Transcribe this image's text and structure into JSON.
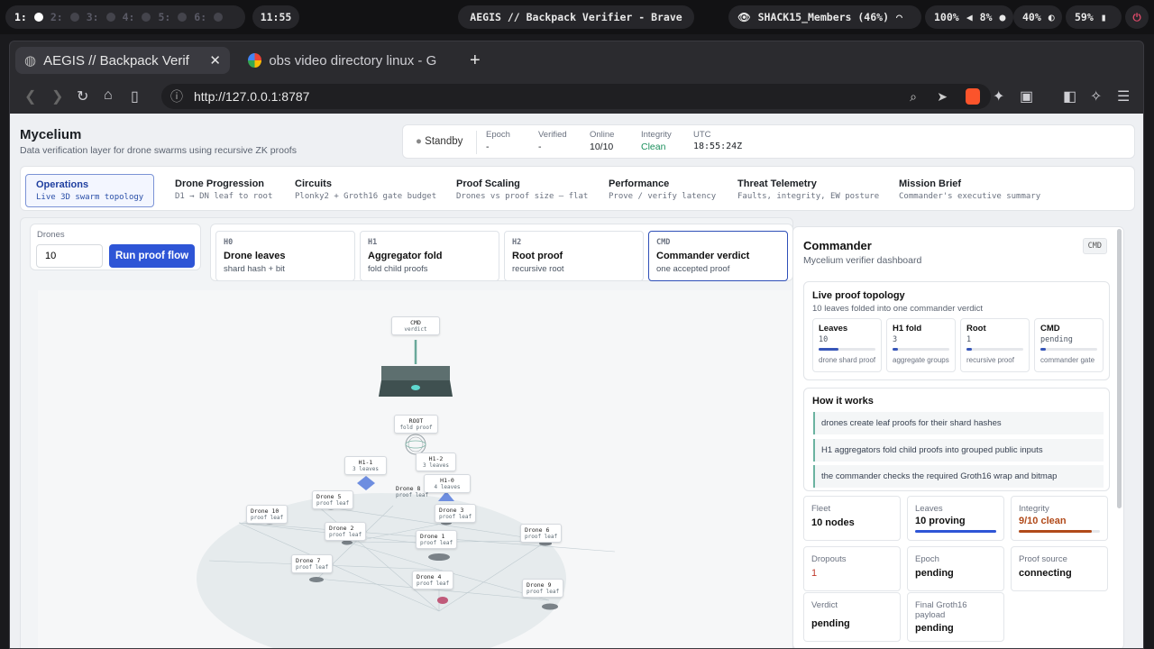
{
  "sysbar": {
    "workspaces": [
      "1:",
      "2:",
      "3:",
      "4:",
      "5:",
      "6:"
    ],
    "clock": "11:55",
    "window_title": "AEGIS // Backpack Verifier - Brave",
    "network": "SHACK15_Members (46%)",
    "brightness": "100%",
    "volume": "8%",
    "cpu": "40%",
    "battery": "59%"
  },
  "browser": {
    "tabs": [
      {
        "label": "AEGIS // Backpack Verif"
      },
      {
        "label": "obs video directory linux - G"
      }
    ],
    "url": "http://127.0.0.1:8787"
  },
  "app": {
    "title": "Mycelium",
    "subtitle": "Data verification layer for drone swarms using recursive ZK proofs",
    "status": {
      "state": "Standby",
      "epoch_label": "Epoch",
      "epoch_value": "-",
      "verified_label": "Verified",
      "verified_value": "-",
      "online_label": "Online",
      "online_value": "10/10",
      "integrity_label": "Integrity",
      "integrity_value": "Clean",
      "utc_label": "UTC",
      "utc_value": "18:55:24Z"
    },
    "nav": [
      {
        "title": "Operations",
        "sub": "Live 3D swarm topology"
      },
      {
        "title": "Drone Progression",
        "sub": "D1 → DN leaf to root"
      },
      {
        "title": "Circuits",
        "sub": "Plonky2 + Groth16 gate budget"
      },
      {
        "title": "Proof Scaling",
        "sub": "Drones vs proof size — flat"
      },
      {
        "title": "Performance",
        "sub": "Prove / verify latency"
      },
      {
        "title": "Threat Telemetry",
        "sub": "Faults, integrity, EW posture"
      },
      {
        "title": "Mission Brief",
        "sub": "Commander's executive summary"
      }
    ],
    "controls": {
      "drones_label": "Drones",
      "drones_value": "10",
      "run_button": "Run proof flow"
    },
    "steps": [
      {
        "key": "H0",
        "name": "Drone leaves",
        "desc": "shard hash + bit"
      },
      {
        "key": "H1",
        "name": "Aggregator fold",
        "desc": "fold child proofs"
      },
      {
        "key": "H2",
        "name": "Root proof",
        "desc": "recursive root"
      },
      {
        "key": "CMD",
        "name": "Commander verdict",
        "desc": "one accepted proof"
      }
    ],
    "scene": {
      "cmd": {
        "a": "CMD",
        "b": "verdict"
      },
      "root": {
        "a": "ROOT",
        "b": "fold proof"
      },
      "h1_1": {
        "a": "H1-1",
        "b": "3 leaves"
      },
      "h1_2": {
        "a": "H1-2",
        "b": "3 leaves"
      },
      "h1_0": {
        "a": "H1-0",
        "b": "4 leaves"
      },
      "drones": [
        {
          "a": "Drone 10",
          "b": "proof leaf"
        },
        {
          "a": "Drone 5",
          "b": "proof leaf"
        },
        {
          "a": "Drone 8",
          "b": "proof leaf"
        },
        {
          "a": "Drone 3",
          "b": "proof leaf"
        },
        {
          "a": "Drone 2",
          "b": "proof leaf"
        },
        {
          "a": "Drone 1",
          "b": "proof leaf"
        },
        {
          "a": "Drone 6",
          "b": "proof leaf"
        },
        {
          "a": "Drone 7",
          "b": "proof leaf"
        },
        {
          "a": "Drone 4",
          "b": "proof leaf"
        },
        {
          "a": "Drone 9",
          "b": "proof leaf"
        }
      ]
    },
    "panel": {
      "title": "Commander",
      "subtitle": "Mycelium verifier dashboard",
      "badge": "CMD",
      "topology_title": "Live proof topology",
      "topology_sub": "10 leaves folded into one commander verdict",
      "tiles": [
        {
          "name": "Leaves",
          "value": "10",
          "desc": "drone shard proofs",
          "fill": 0.35
        },
        {
          "name": "H1 fold",
          "value": "3",
          "desc": "aggregate groups",
          "fill": 0.1
        },
        {
          "name": "Root",
          "value": "1",
          "desc": "recursive proof",
          "fill": 0.1
        },
        {
          "name": "CMD",
          "value": "pending",
          "desc": "commander gate",
          "fill": 0.1
        }
      ],
      "how_title": "How it works",
      "how": [
        "drones create leaf proofs for their shard hashes",
        "H1 aggregators fold child proofs into grouped public inputs",
        "the commander checks the required Groth16 wrap and bitmap"
      ],
      "stats": [
        {
          "label": "Fleet",
          "value": "10 nodes"
        },
        {
          "label": "Leaves",
          "value": "10 proving"
        },
        {
          "label": "Integrity",
          "value": "9/10 clean"
        },
        {
          "label": "Dropouts",
          "value": "1"
        },
        {
          "label": "Epoch",
          "value": "pending"
        },
        {
          "label": "Proof source",
          "value": "connecting"
        },
        {
          "label": "Verdict",
          "value": "pending"
        },
        {
          "label": "Final Groth16 payload",
          "value": "pending"
        }
      ],
      "leaves_fill": 1.0,
      "integrity_fill": 0.9
    },
    "colors": {
      "accent": "#2e55d6",
      "clean": "#1a8f5c",
      "warn": "#b14a1a",
      "danger": "#c0392b"
    }
  }
}
